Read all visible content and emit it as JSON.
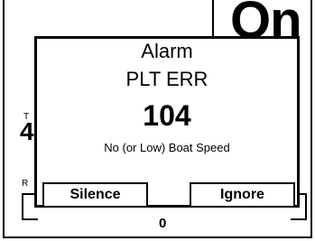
{
  "background": {
    "big_value": "On",
    "label_t": "T",
    "glyph": "4",
    "label_r": "R",
    "bottom_value": "0"
  },
  "dialog": {
    "title": "Alarm",
    "code_label": "PLT ERR",
    "code": "104",
    "description": "No (or Low) Boat Speed"
  },
  "buttons": {
    "silence": "Silence",
    "ignore": "Ignore"
  }
}
